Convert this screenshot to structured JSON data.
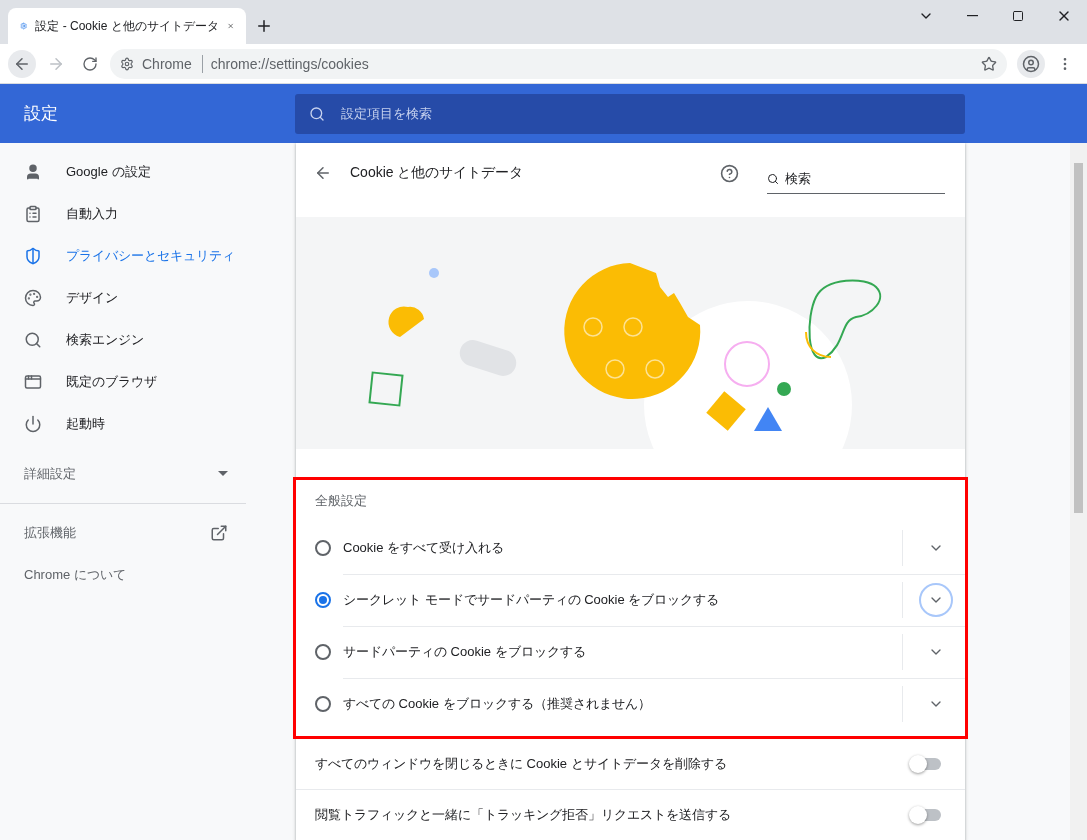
{
  "browser": {
    "tab_title": "設定 - Cookie と他のサイトデータ",
    "origin": "Chrome",
    "url": "chrome://settings/cookies"
  },
  "header": {
    "title": "設定",
    "search": {
      "placeholder": "設定項目を検索"
    }
  },
  "sidebar": {
    "items": [
      {
        "label": "Google の設定",
        "kind": "person",
        "selected": false
      },
      {
        "label": "自動入力",
        "kind": "clipboard",
        "selected": false
      },
      {
        "label": "プライバシーとセキュリティ",
        "kind": "shield",
        "selected": true
      },
      {
        "label": "デザイン",
        "kind": "palette",
        "selected": false
      },
      {
        "label": "検索エンジン",
        "kind": "search",
        "selected": false
      },
      {
        "label": "既定のブラウザ",
        "kind": "browser",
        "selected": false
      },
      {
        "label": "起動時",
        "kind": "power",
        "selected": false
      }
    ],
    "advanced": {
      "label": "詳細設定",
      "expanded": false
    },
    "links": [
      {
        "label": "拡張機能",
        "kind": "external"
      },
      {
        "label": "Chrome について",
        "kind": "plain"
      }
    ]
  },
  "page": {
    "title": "Cookie と他のサイトデータ",
    "search": {
      "placeholder": "検索"
    },
    "general": {
      "heading": "全般設定",
      "highlighted": true,
      "options": [
        {
          "label": "Cookie をすべて受け入れる",
          "selected": false,
          "focused": false
        },
        {
          "label": "シークレット モードでサードパーティの Cookie をブロックする",
          "selected": true,
          "focused": true
        },
        {
          "label": "サードパーティの Cookie をブロックする",
          "selected": false,
          "focused": false
        },
        {
          "label": "すべての Cookie をブロックする（推奨されません）",
          "selected": false,
          "focused": false
        }
      ]
    },
    "toggles": [
      {
        "label": "すべてのウィンドウを閉じるときに Cookie とサイトデータを削除する",
        "on": false
      },
      {
        "label": "閲覧トラフィックと一緒に「トラッキング拒否」リクエストを送信する",
        "on": false
      }
    ]
  }
}
